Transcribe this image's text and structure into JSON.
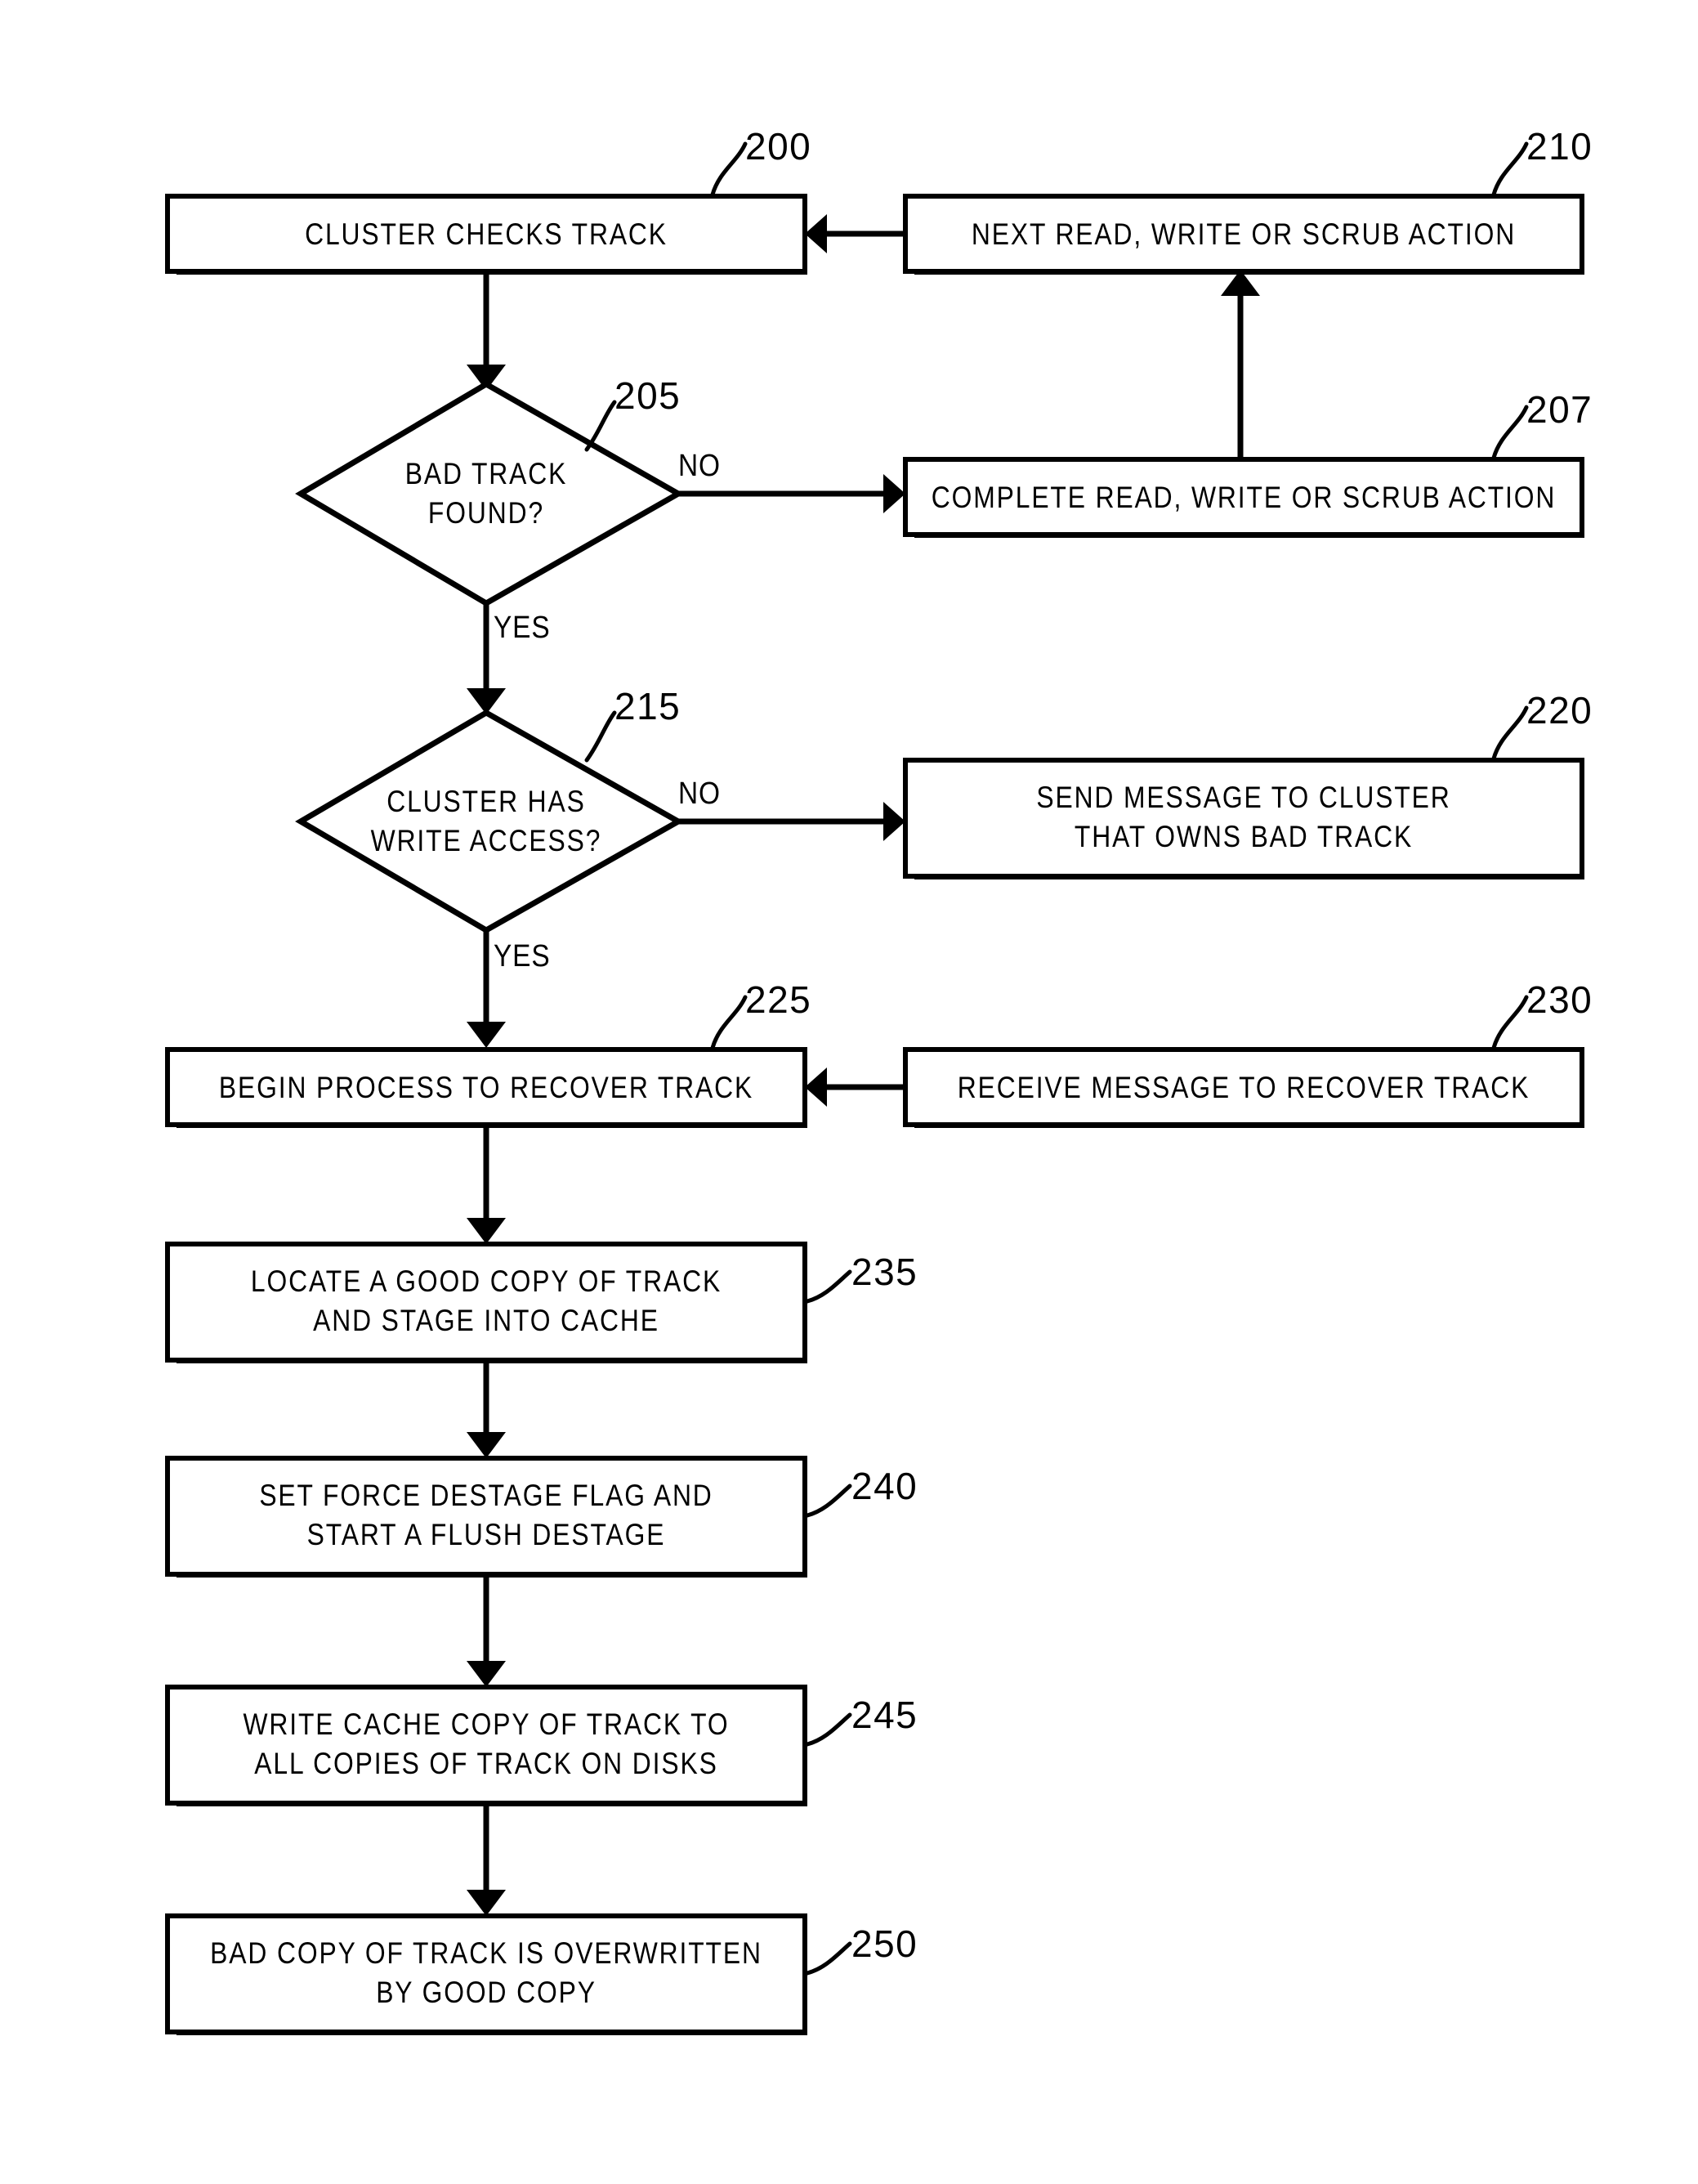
{
  "figure": {
    "type": "patent-flowchart",
    "background": "#ffffff",
    "ink": "#000000"
  },
  "nodes": {
    "n200": {
      "ref": "200",
      "shape": "process",
      "line1": "CLUSTER CHECKS TRACK",
      "line2": ""
    },
    "n210": {
      "ref": "210",
      "shape": "process",
      "line1": "NEXT READ, WRITE OR SCRUB ACTION",
      "line2": ""
    },
    "n205": {
      "ref": "205",
      "shape": "decision",
      "line1": "BAD TRACK",
      "line2": "FOUND?"
    },
    "n207": {
      "ref": "207",
      "shape": "process",
      "line1": "COMPLETE READ, WRITE OR SCRUB ACTION",
      "line2": ""
    },
    "n215": {
      "ref": "215",
      "shape": "decision",
      "line1": "CLUSTER HAS",
      "line2": "WRITE ACCESS?"
    },
    "n220": {
      "ref": "220",
      "shape": "process",
      "line1": "SEND MESSAGE TO CLUSTER",
      "line2": "THAT OWNS BAD TRACK"
    },
    "n225": {
      "ref": "225",
      "shape": "process",
      "line1": "BEGIN PROCESS TO RECOVER TRACK",
      "line2": ""
    },
    "n230": {
      "ref": "230",
      "shape": "process",
      "line1": "RECEIVE MESSAGE TO RECOVER TRACK",
      "line2": ""
    },
    "n235": {
      "ref": "235",
      "shape": "process",
      "line1": "LOCATE A GOOD COPY OF TRACK",
      "line2": "AND STAGE INTO CACHE"
    },
    "n240": {
      "ref": "240",
      "shape": "process",
      "line1": "SET FORCE DESTAGE FLAG AND",
      "line2": "START A FLUSH DESTAGE"
    },
    "n245": {
      "ref": "245",
      "shape": "process",
      "line1": "WRITE CACHE COPY OF TRACK TO",
      "line2": "ALL COPIES OF TRACK ON DISKS"
    },
    "n250": {
      "ref": "250",
      "shape": "process",
      "line1": "BAD COPY OF TRACK IS OVERWRITTEN",
      "line2": "BY GOOD COPY"
    }
  },
  "edge_labels": {
    "e205_no": "NO",
    "e205_yes": "YES",
    "e215_no": "NO",
    "e215_yes": "YES"
  },
  "flow": [
    {
      "from": "210",
      "to": "200",
      "label": ""
    },
    {
      "from": "200",
      "to": "205",
      "label": ""
    },
    {
      "from": "205",
      "to": "207",
      "label": "NO"
    },
    {
      "from": "207",
      "to": "210",
      "label": ""
    },
    {
      "from": "205",
      "to": "215",
      "label": "YES"
    },
    {
      "from": "215",
      "to": "220",
      "label": "NO"
    },
    {
      "from": "215",
      "to": "225",
      "label": "YES"
    },
    {
      "from": "230",
      "to": "225",
      "label": ""
    },
    {
      "from": "225",
      "to": "235",
      "label": ""
    },
    {
      "from": "235",
      "to": "240",
      "label": ""
    },
    {
      "from": "240",
      "to": "245",
      "label": ""
    },
    {
      "from": "245",
      "to": "250",
      "label": ""
    }
  ]
}
